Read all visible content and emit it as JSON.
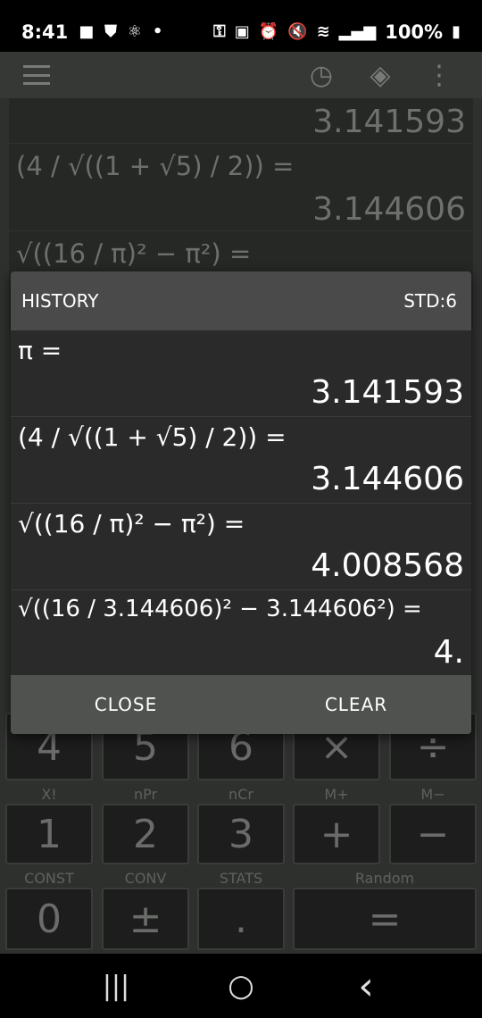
{
  "status_bar": {
    "time": "8:41",
    "battery": "100%",
    "icons_left": [
      "video-icon",
      "shield-icon",
      "atom-icon",
      "dot-icon"
    ],
    "icons_right": [
      "key-icon",
      "battery-saver-icon",
      "alarm-icon",
      "mute-icon",
      "wifi-icon",
      "signal-icon",
      "battery-icon"
    ]
  },
  "background": {
    "history": [
      {
        "value": "3.141593"
      },
      {
        "expr": "(4 / √((1 + √5) / 2)) =",
        "value": "3.144606"
      },
      {
        "expr": "√((16 / π)² − π²) ="
      }
    ],
    "keys": {
      "row1": [
        "4",
        "5",
        "6",
        "×",
        "÷"
      ],
      "fn2": [
        "X!",
        "nPr",
        "nCr",
        "M+",
        "M−"
      ],
      "row2": [
        "1",
        "2",
        "3",
        "+",
        "−"
      ],
      "fn3": [
        "CONST",
        "CONV",
        "STATS",
        "Random"
      ],
      "row3": [
        "0",
        "±",
        ".",
        "="
      ]
    }
  },
  "dialog": {
    "title": "HISTORY",
    "mode": "STD:6",
    "entries": [
      {
        "expr": "π =",
        "result": "3.141593"
      },
      {
        "expr": "(4 / √((1 + √5) / 2)) =",
        "result": "3.144606"
      },
      {
        "expr": "√((16 / π)² − π²) =",
        "result": "4.008568"
      },
      {
        "expr": "√((16 / 3.144606)² − 3.144606²) =",
        "result": "4."
      }
    ],
    "close_label": "CLOSE",
    "clear_label": "CLEAR"
  },
  "nav": {
    "recents": "|||",
    "home": "○",
    "back": "‹"
  }
}
